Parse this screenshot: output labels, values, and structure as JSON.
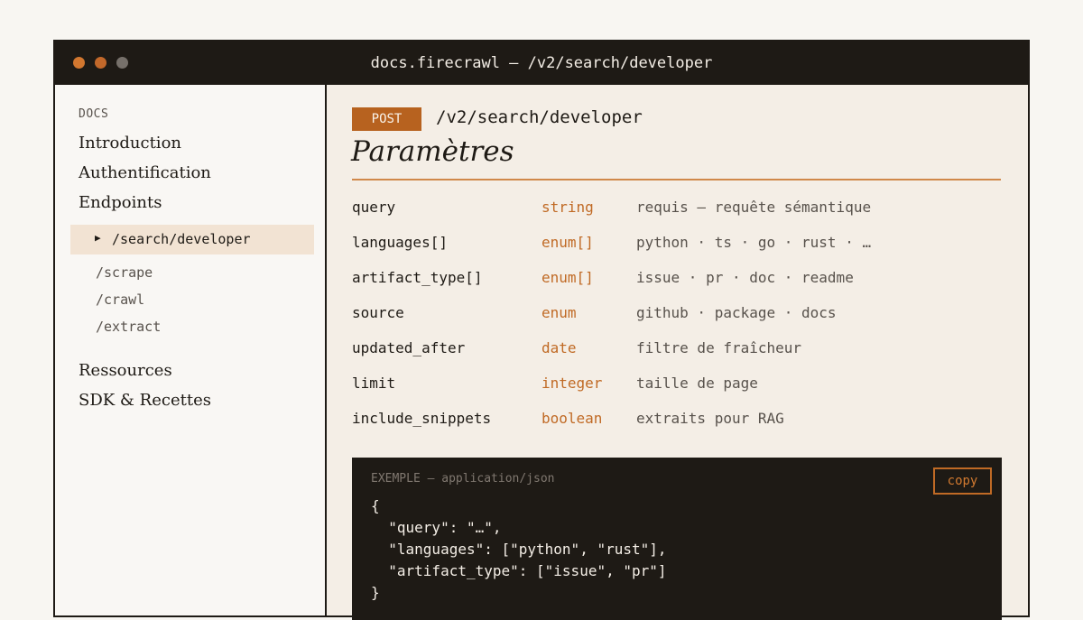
{
  "window": {
    "title": "docs.firecrawl — /v2/search/developer"
  },
  "sidebar": {
    "heading": "DOCS",
    "items": [
      "Introduction",
      "Authentification",
      "Endpoints"
    ],
    "active": "/search/developer",
    "subitems": [
      "/scrape",
      "/crawl",
      "/extract"
    ],
    "bottom_items": [
      "Ressources",
      "SDK & Recettes"
    ]
  },
  "main": {
    "method": "POST",
    "endpoint": "/v2/search/developer",
    "section_title": "Paramètres",
    "params": [
      {
        "name": "query",
        "type": "string",
        "desc": "requis — requête sémantique"
      },
      {
        "name": "languages[]",
        "type": "enum[]",
        "desc": "python · ts · go · rust · …"
      },
      {
        "name": "artifact_type[]",
        "type": "enum[]",
        "desc": "issue · pr · doc · readme"
      },
      {
        "name": "source",
        "type": "enum",
        "desc": "github · package · docs"
      },
      {
        "name": "updated_after",
        "type": "date",
        "desc": "filtre de fraîcheur"
      },
      {
        "name": "limit",
        "type": "integer",
        "desc": "taille de page"
      },
      {
        "name": "include_snippets",
        "type": "boolean",
        "desc": "extraits pour RAG"
      }
    ],
    "example": {
      "header": "EXEMPLE — application/json",
      "copy_label": "copy",
      "lines": [
        "{",
        "  \"query\": \"…\",",
        "  \"languages\": [\"python\", \"rust\"],",
        "  \"artifact_type\": [\"issue\", \"pr\"]",
        "}"
      ]
    }
  },
  "colors": {
    "accent": "#b7621f",
    "dark": "#1e1a15",
    "panel": "#f4eee6",
    "highlight": "#f2e3d3"
  }
}
